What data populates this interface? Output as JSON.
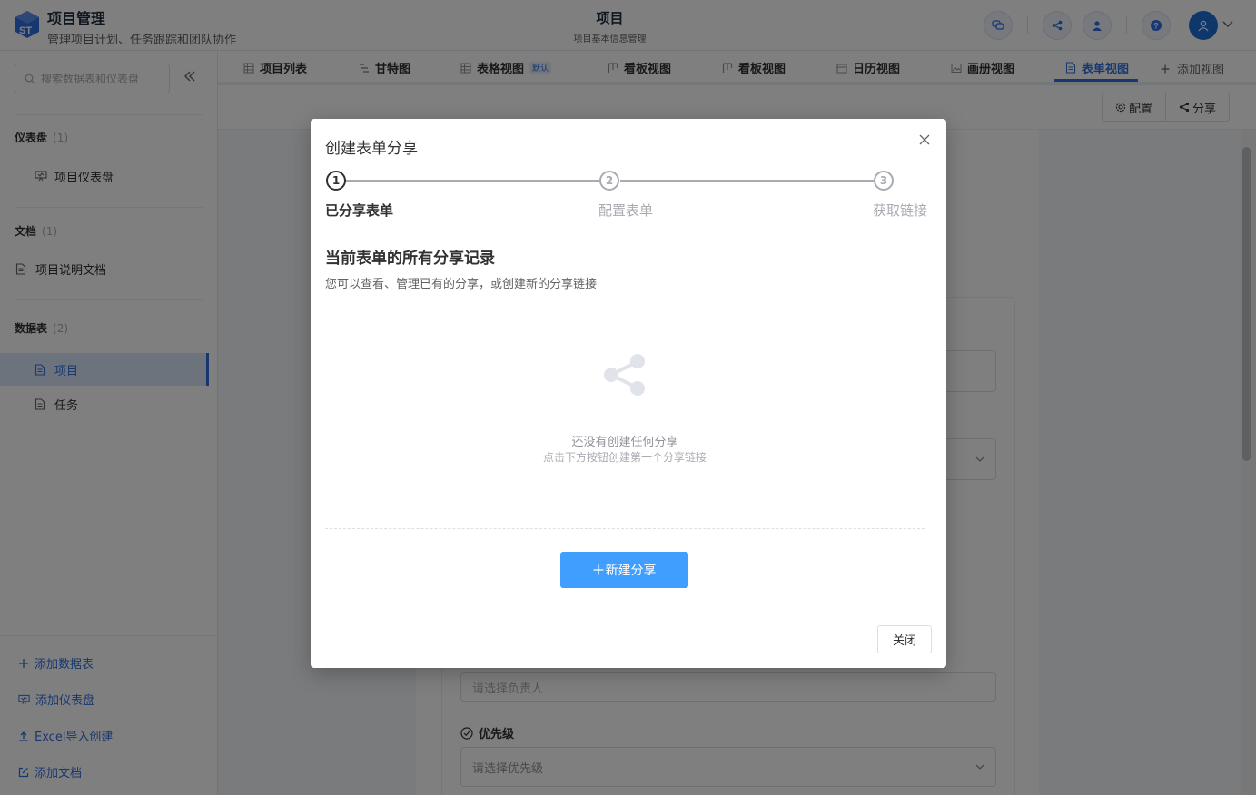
{
  "header": {
    "app_title": "项目管理",
    "app_subtitle": "管理项目计划、任务跟踪和团队协作",
    "page_title": "项目",
    "page_subtitle": "项目基本信息管理",
    "logo_text": "ST"
  },
  "sidebar": {
    "search_placeholder": "搜索数据表和仪表盘",
    "sections": [
      {
        "title": "仪表盘",
        "count": "(1)",
        "items": [
          {
            "label": "项目仪表盘",
            "icon": "dashboard-icon"
          }
        ]
      },
      {
        "title": "文档",
        "count": "(1)",
        "items": [
          {
            "label": "项目说明文档",
            "icon": "document-icon"
          }
        ]
      },
      {
        "title": "数据表",
        "count": "(2)",
        "items": [
          {
            "label": "项目",
            "icon": "table-doc-icon",
            "active": true
          },
          {
            "label": "任务",
            "icon": "table-doc-icon"
          }
        ]
      }
    ],
    "bottom_actions": [
      {
        "label": "添加数据表",
        "icon": "plus-icon"
      },
      {
        "label": "添加仪表盘",
        "icon": "dashboard-icon"
      },
      {
        "label": "Excel导入创建",
        "icon": "upload-icon"
      },
      {
        "label": "添加文档",
        "icon": "edit-icon"
      }
    ]
  },
  "tabs": {
    "items": [
      {
        "label": "项目列表",
        "icon": "grid-icon"
      },
      {
        "label": "甘特图",
        "icon": "gantt-icon"
      },
      {
        "label": "表格视图",
        "icon": "grid-icon",
        "badge": "默认"
      },
      {
        "label": "看板视图",
        "icon": "kanban-icon"
      },
      {
        "label": "看板视图",
        "icon": "kanban-icon"
      },
      {
        "label": "日历视图",
        "icon": "calendar-icon"
      },
      {
        "label": "画册视图",
        "icon": "image-icon"
      },
      {
        "label": "表单视图",
        "icon": "form-icon",
        "active": true
      }
    ],
    "add_label": "添加视图"
  },
  "toolbar": {
    "config_label": "配置",
    "share_label": "分享"
  },
  "form_background": {
    "owner_placeholder": "请选择负责人",
    "priority_label": "优先级",
    "priority_placeholder": "请选择优先级"
  },
  "dialog": {
    "title": "创建表单分享",
    "steps": [
      {
        "number": "1",
        "label": "已分享表单",
        "done": true
      },
      {
        "number": "2",
        "label": "配置表单",
        "done": false
      },
      {
        "number": "3",
        "label": "获取链接",
        "done": false
      }
    ],
    "heading": "当前表单的所有分享记录",
    "description": "您可以查看、管理已有的分享，或创建新的分享链接",
    "empty_title": "还没有创建任何分享",
    "empty_hint": "点击下方按钮创建第一个分享链接",
    "new_share_label": "新建分享",
    "close_label": "关闭"
  },
  "colors": {
    "primary": "#2f6fe0",
    "button_blue": "#409eff",
    "overlay": "rgba(0,0,0,0.5)"
  }
}
